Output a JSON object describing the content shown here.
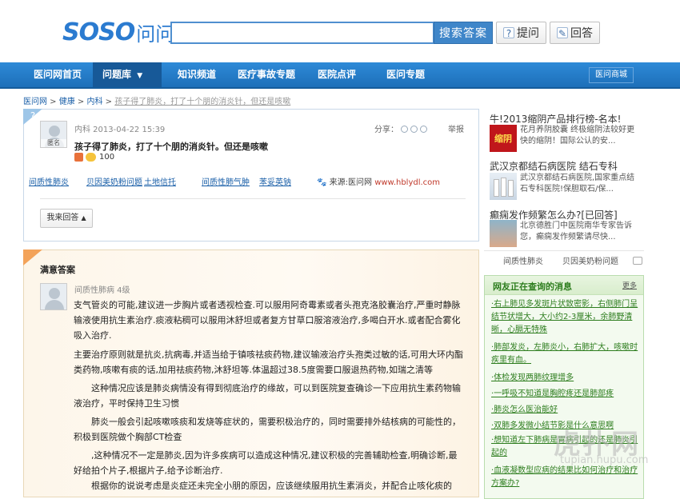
{
  "logo": {
    "brand": "SOSO",
    "suffix": "问问"
  },
  "search": {
    "placeholder": "",
    "button": "搜索答案"
  },
  "top_buttons": {
    "ask": "提问",
    "answer": "回答"
  },
  "nav": {
    "items": [
      "医问网首页",
      "问题库",
      "知识频道",
      "医疗事故专题",
      "医院点评",
      "医问专题"
    ],
    "mall": "医问商城"
  },
  "breadcrumb": {
    "items": [
      "医问网",
      "健康",
      "内科"
    ],
    "current": "孩子得了肺炎，打了十个朋的消炎针，但还是咳嗽"
  },
  "question": {
    "tab": "?",
    "avatar_tag": "匿名",
    "meta": "内科  2013-04-22 15:39",
    "title": "孩子得了肺炎，打了十个朋的消炎针。但还是咳嗽",
    "score": "100",
    "share_label": "分享：",
    "report": "举报",
    "related": [
      "间质性肺炎",
      "贝因美奶粉问题",
      "土地信托",
      "间质性肺气肿",
      "苯妥英钠"
    ],
    "source_label": "来源:医问网",
    "source_url": "www.hblydl.com",
    "my_answer": "我来回答"
  },
  "answer": {
    "title": "满意答案",
    "meta": "间质性肺病  4级",
    "paragraphs": [
      "支气管炎的可能,建议进一步胸片或者透视检查.可以服用阿奇霉素或者头孢克洛胶囊治疗,严重时静脉输液使用抗生素治疗.痰液粘稠可以服用沐舒坦或者复方甘草口服溶液治疗,多喝白开水.或者配合雾化吸入治疗.",
      "主要治疗原则就是抗炎,抗病毒,并适当给于镇咳祛痰药物,建议输液治疗头孢类过敏的话,可用大环内酯类药物,咳嗽有痰的话,加用祛痰药物,沐舒坦等.体温超过38.5度需要口服退热药物,如瑞之清等",
      "　　这种情况应该是肺炎病情没有得到彻底治疗的缘故，可以到医院复查确诊一下应用抗生素药物输液治疗，平时保持卫生习惯",
      "　　肺炎一般会引起咳嗽咳痰和发烧等症状的，需要积极治疗的，同时需要排外结核病的可能性的，积极到医院做个胸部CT检查",
      "　　,这种情况不一定是肺炎,因为许多疾病可以造成这种情况,建议积极的完善辅助检查,明确诊断,最好给拍个片子,根据片子,给予诊断治疗.",
      "　　根据你的说说考虑是炎症还未完全小朋的原因，应该继续服用抗生素消炎，并配合止咳化痰的"
    ]
  },
  "sidebar": {
    "ads": [
      {
        "title_red": "牛!",
        "title": "2013缩阴产品排行榜-名本!",
        "thumb_text": "缩阴",
        "text": "花月养阴胶囊 终极缩阴法较好更快的缩阴！国际公认的安..."
      },
      {
        "title": "武汉京都结石病医院 结石专科",
        "text": "武汉京都结石病医院,国家重点结石专科医院!保胆取石/保..."
      },
      {
        "title": "癫痫发作频繁怎么办?[已回答]",
        "text": "北京德胜门中医院南华专家告诉您，癫痫发作频繁请尽快..."
      }
    ],
    "tabs": [
      "间质性肺炎",
      "贝因美奶粉问题"
    ],
    "live": {
      "title": "网友正在查询的消息",
      "more": "更多",
      "items": [
        "·右上肺见多发斑片状致密影，右侧肺门呈结节状增大，大小约2-3厘米，余肺野清晰，心膈无特殊",
        "·肺部发炎，左肺炎小，右肺扩大，咳嗽时疾里有血。",
        "·体检发现两肺纹理增多",
        "·一呼吸不知道是胸腔疼还是肺部疼",
        "·肺炎怎么医治能好",
        "·双肺多发微小结节影是什么意思啊",
        "·想知道左下肺病是胃病引起的还是肺炎引起的",
        "·血液凝数型应病的结果比如何治疗和治疗方案办?"
      ]
    }
  },
  "watermark": {
    "main": "虎扑网",
    "sub": "tupian.hupu.com"
  }
}
